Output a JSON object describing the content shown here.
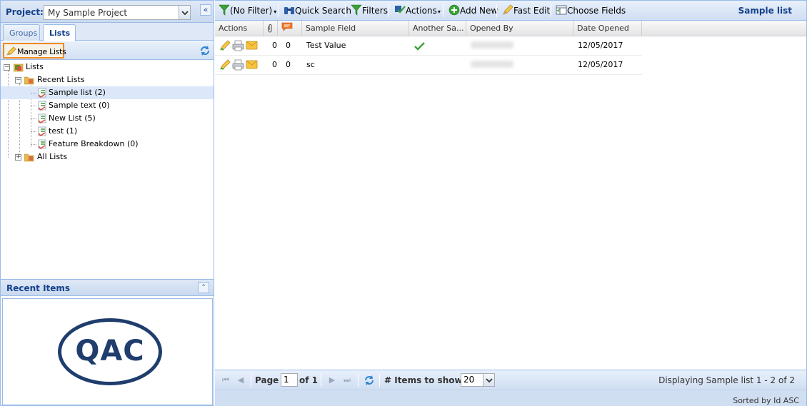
{
  "left": {
    "project_label": "Project:",
    "project_value": "My Sample Project",
    "collapse_glyph": "«",
    "tabs": [
      {
        "label": "Groups",
        "active": false
      },
      {
        "label": "Lists",
        "active": true
      }
    ],
    "manage_lists": "Manage Lists",
    "tree": {
      "root": "Lists",
      "recent_lists": "Recent Lists",
      "items": [
        {
          "label": "Sample list (2)",
          "selected": true
        },
        {
          "label": "Sample text (0)",
          "selected": false
        },
        {
          "label": "New List (5)",
          "selected": false
        },
        {
          "label": "test (1)",
          "selected": false
        },
        {
          "label": "Feature Breakdown (0)",
          "selected": false
        }
      ],
      "all_lists": "All Lists"
    },
    "recent_items_title": "Recent Items",
    "recent_items_toggle_glyph": "⌃",
    "logo_text": "QAC"
  },
  "toolbar": {
    "filter": "(No Filter)",
    "quick_search": "Quick Search",
    "filters": "Filters",
    "actions": "Actions",
    "add_new": "Add New",
    "fast_edit": "Fast Edit",
    "choose_fields": "Choose Fields",
    "title": "Sample list"
  },
  "grid": {
    "headers": [
      "Actions",
      "",
      "",
      "Sample Field",
      "Another Sa...",
      "Opened By",
      "Date Opened"
    ],
    "rows": [
      {
        "attach": "0",
        "comments": "0",
        "sample_field": "Test Value",
        "another_checked": true,
        "opened_by": "",
        "date_opened": "12/05/2017"
      },
      {
        "attach": "0",
        "comments": "0",
        "sample_field": "sc",
        "another_checked": false,
        "opened_by": "",
        "date_opened": "12/05/2017"
      }
    ]
  },
  "pager": {
    "page_label": "Page",
    "page_value": "1",
    "of_label": "of 1",
    "items_label": "# Items to show:",
    "items_value": "20",
    "displaying": "Displaying Sample list 1 - 2 of 2",
    "sorted": "Sorted by Id ASC"
  },
  "colors": {
    "header_blue": "#15428b",
    "border_blue": "#99bbe8",
    "highlight_orange": "#f08a24",
    "selection": "#dce8f9"
  }
}
